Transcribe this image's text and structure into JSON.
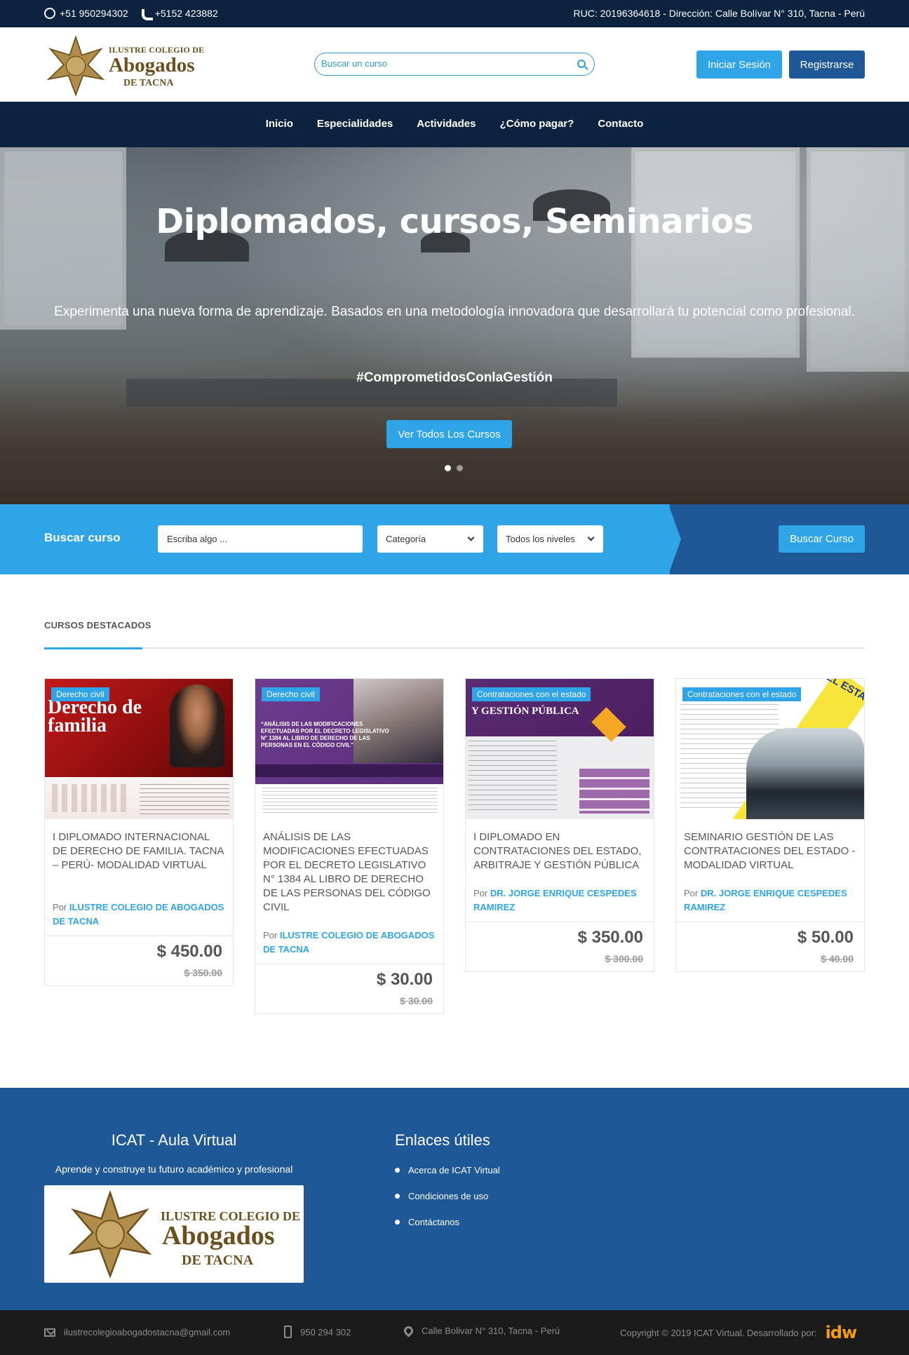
{
  "topbar": {
    "whatsapp": "+51 950294302",
    "phone": "+5152 423882",
    "info": "RUC: 20196364618 - Dirección: Calle Bolívar N° 310, Tacna - Perú"
  },
  "logo": {
    "line1": "ILUSTRE COLEGIO DE",
    "line2": "Abogados",
    "line3": "DE TACNA"
  },
  "header": {
    "search_placeholder": "Buscar un curso",
    "login": "Iniciar Sesión",
    "register": "Registrarse"
  },
  "nav": [
    "Inicio",
    "Especialidades",
    "Actividades",
    "¿Cómo pagar?",
    "Contacto"
  ],
  "hero": {
    "title": "Diplomados, cursos, Seminarios",
    "subtitle": "Experimenta una nueva forma de aprendizaje. Basados en una metodología innovadora que desarrollará tu potencial como profesional.",
    "hashtag": "#ComprometidosConlaGestión",
    "cta": "Ver Todos Los Cursos",
    "slides": 2,
    "active_slide": 1
  },
  "search": {
    "title": "Buscar curso",
    "placeholder": "Escriba algo ...",
    "category": "Categoría",
    "level": "Todos los niveles",
    "button": "Buscar Curso"
  },
  "featured": {
    "title": "CURSOS DESTACADOS",
    "courses": [
      {
        "badge": "Derecho civil",
        "thumb_text": "Derecho de familia",
        "title": "I Diplomado Internacional de Derecho de Familia. Tacna – Perú- Modalidad Virtual",
        "by": "Por",
        "author": "ILUSTRE COLEGIO DE ABOGADOS DE TACNA",
        "price": "$ 450.00",
        "old_price": "$ 350.00"
      },
      {
        "badge": "Derecho civil",
        "thumb_text": "“ANÁLISIS DE LAS MODIFICACIONES EFECTUADAS POR EL DECRETO LEGISLATIVO N° 1384 AL LIBRO DE DERECHO DE LAS PERSONAS EN EL CÓDIGO CIVIL”",
        "title": "Análisis de las modificaciones efectuadas por el Decreto Legislativo N° 1384 al libro de derecho de las personas del código civil",
        "by": "Por",
        "author": "ILUSTRE COLEGIO DE ABOGADOS DE TACNA",
        "price": "$ 30.00",
        "old_price": "$ 30.00"
      },
      {
        "badge": "Contrataciones con el estado",
        "thumb_text": "Y GESTIÓN PÚBLICA",
        "title": "I Diplomado en Contrataciones del Estado, Arbitraje y Gestión Pública",
        "by": "Por",
        "author": "DR. JORGE ENRIQUE CESPEDES RAMIREZ",
        "price": "$ 350.00",
        "old_price": "$ 300.00"
      },
      {
        "badge": "Contrataciones con el estado",
        "thumb_text": "DEL ESTADO",
        "title": "Seminario Gestión de las Contrataciones del Estado - Modalidad Virtual",
        "by": "Por",
        "author": "DR. JORGE ENRIQUE CESPEDES RAMIREZ",
        "price": "$ 50.00",
        "old_price": "$ 40.00"
      }
    ]
  },
  "footer": {
    "left_title": "ICAT - Aula Virtual",
    "left_text": "Aprende y construye tu futuro académico y profesional",
    "right_title": "Enlaces útiles",
    "links": [
      "Acerca de ICAT Virtual",
      "Condiciones de uso",
      "Contáctanos"
    ]
  },
  "bottombar": {
    "email": "ilustrecolegioabogadostacna@gmail.com",
    "phone": "950 294 302",
    "address": "Calle Bolivar N° 310, Tacna - Perú",
    "copyright": "Copyright © 2019 ICAT Virtual. Desarrollado por:",
    "dev_logo": "idw"
  },
  "colors": {
    "dark_navy": "#0c2340",
    "accent_blue": "#2fa4e7",
    "deep_blue": "#1e5896",
    "gold": "#6b4f1d"
  }
}
